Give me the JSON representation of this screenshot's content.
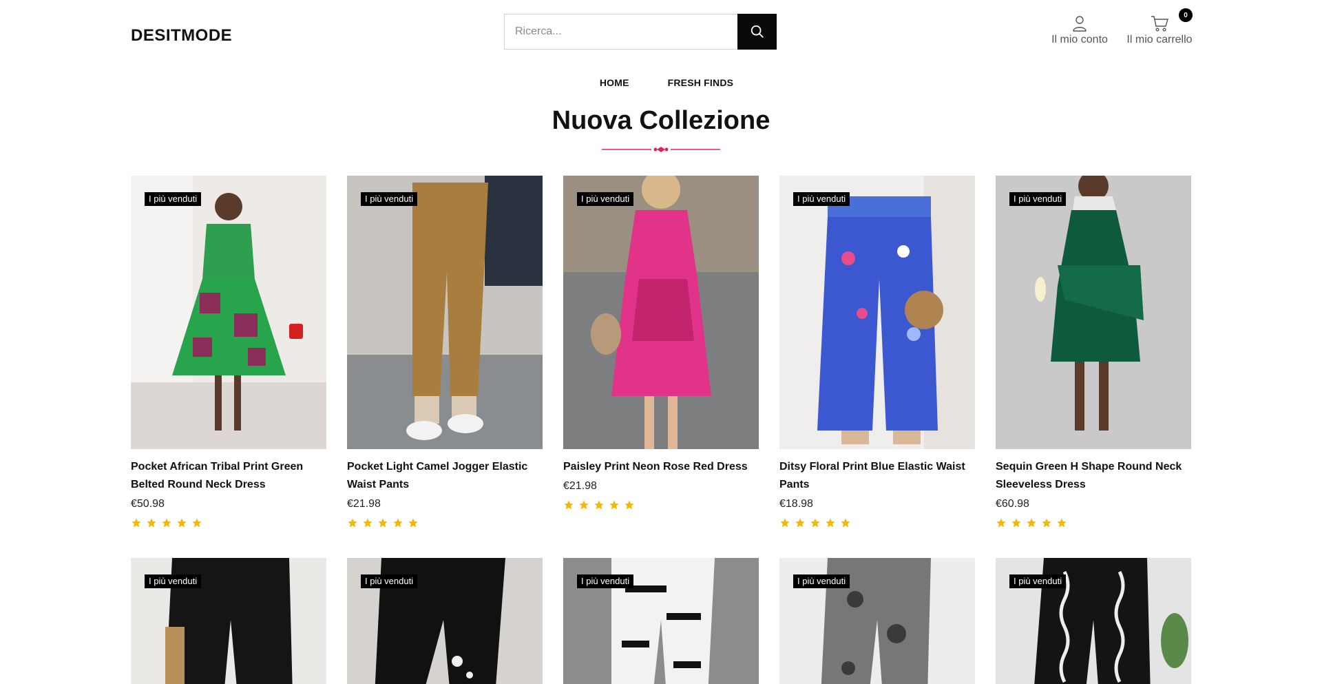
{
  "brand": {
    "logo_text": "DESITMODE"
  },
  "search": {
    "placeholder": "Ricerca..."
  },
  "header": {
    "account_label": "Il mio conto",
    "cart_label": "Il mio carrello",
    "cart_count": "0"
  },
  "nav": {
    "items": [
      {
        "label": "HOME"
      },
      {
        "label": "FRESH FINDS"
      }
    ]
  },
  "section": {
    "title": "Nuova Collezione"
  },
  "colors": {
    "accent": "#e0245e",
    "star": "#f5b800",
    "badge_bg": "#000000"
  },
  "products": [
    {
      "badge": "I più venduti",
      "name": "Pocket African Tribal Print Green Belted Round Neck Dress",
      "price": "€50.98",
      "rating": 5,
      "image": "green-african-print-dress-photo"
    },
    {
      "badge": "I più venduti",
      "name": "Pocket Light Camel Jogger Elastic Waist Pants",
      "price": "€21.98",
      "rating": 5,
      "image": "camel-jogger-pants-photo"
    },
    {
      "badge": "I più venduti",
      "name": "Paisley Print Neon Rose Red Dress",
      "price": "€21.98",
      "rating": 5,
      "image": "neon-rose-paisley-dress-photo"
    },
    {
      "badge": "I più venduti",
      "name": "Ditsy Floral Print Blue Elastic Waist Pants",
      "price": "€18.98",
      "rating": 5,
      "image": "blue-floral-pants-photo"
    },
    {
      "badge": "I più venduti",
      "name": "Sequin Green H Shape Round Neck Sleeveless Dress",
      "price": "€60.98",
      "rating": 5,
      "image": "green-sequin-dress-photo"
    },
    {
      "badge": "I più venduti",
      "image": "black-cargo-pants-photo"
    },
    {
      "badge": "I più venduti",
      "image": "black-star-leggings-photo"
    },
    {
      "badge": "I più venduti",
      "image": "loving-print-leggings-photo"
    },
    {
      "badge": "I più venduti",
      "image": "snakeskin-leggings-photo"
    },
    {
      "badge": "I più venduti",
      "image": "black-white-wave-pants-photo"
    }
  ]
}
